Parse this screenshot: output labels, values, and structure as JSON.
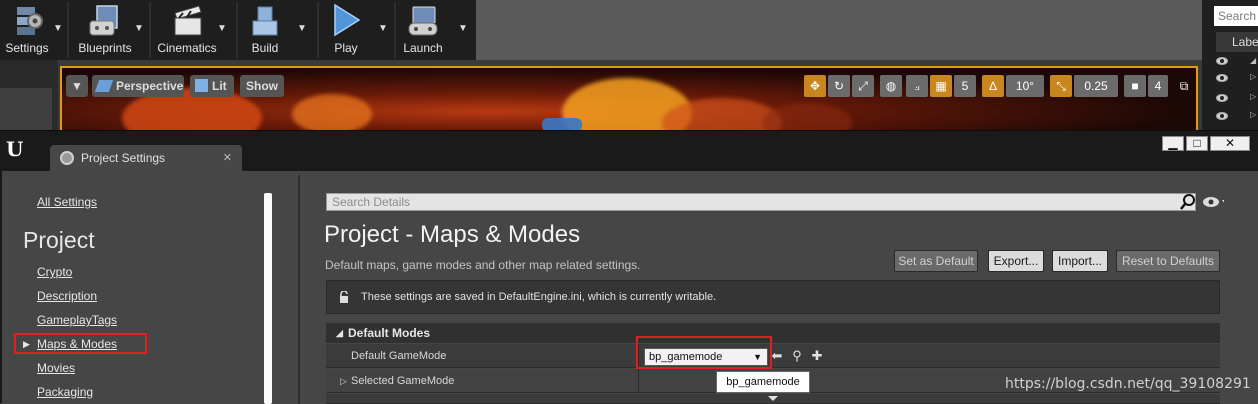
{
  "toolbar": {
    "buttons": [
      {
        "label": "Settings",
        "icon": "gear-icon"
      },
      {
        "label": "Blueprints",
        "icon": "blueprints-icon"
      },
      {
        "label": "Cinematics",
        "icon": "clapperboard-icon"
      },
      {
        "label": "Build",
        "icon": "build-blocks-icon"
      },
      {
        "label": "Play",
        "icon": "play-icon"
      },
      {
        "label": "Launch",
        "icon": "gamepad-icon"
      }
    ]
  },
  "viewport": {
    "perspective_label": "Perspective",
    "lit_label": "Lit",
    "show_label": "Show",
    "grid_snap_value": "5",
    "rotation_snap_value": "10°",
    "scale_snap_value": "0.25",
    "camera_speed_value": "4"
  },
  "outliner": {
    "search_placeholder": "Search",
    "label_header": "Labe"
  },
  "window": {
    "tab_title": "Project Settings",
    "tab_close": "✕",
    "logo": "U"
  },
  "nav": {
    "all_settings": "All Settings",
    "project_heading": "Project",
    "items": [
      "Crypto",
      "Description",
      "GameplayTags",
      "Maps & Modes",
      "Movies",
      "Packaging"
    ],
    "selected_index": 3
  },
  "details": {
    "search_placeholder": "Search Details",
    "page_title": "Project - Maps & Modes",
    "page_subtitle": "Default maps, game modes and other map related settings.",
    "buttons": {
      "set_default": "Set as Default",
      "export": "Export...",
      "import": "Import...",
      "reset": "Reset to Defaults"
    },
    "notice_text": "These settings are saved in DefaultEngine.ini, which is currently writable.",
    "section_header": "Default Modes",
    "rows": {
      "default_gamemode_label": "Default GameMode",
      "default_gamemode_value": "bp_gamemode",
      "selected_gamemode_label": "Selected GameMode"
    },
    "tooltip": "bp_gamemode"
  },
  "watermark": "https://blog.csdn.net/qq_39108291",
  "colors": {
    "accent_orange": "#e29a12",
    "highlight_red": "#e02020"
  }
}
